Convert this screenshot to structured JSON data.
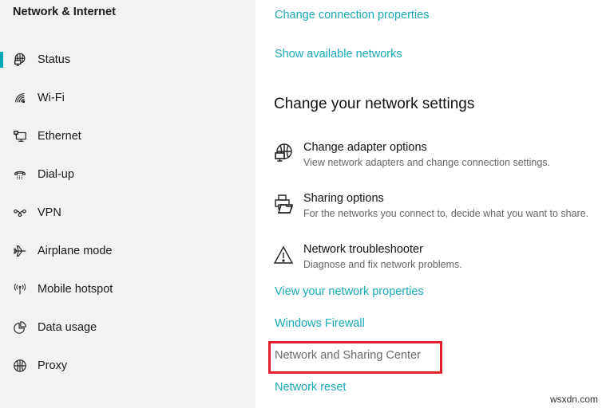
{
  "sidebar": {
    "title": "Network & Internet",
    "accent_color": "#00a8b5",
    "items": [
      {
        "label": "Status",
        "icon": "globe-monitor-icon",
        "selected": true
      },
      {
        "label": "Wi-Fi",
        "icon": "wifi-icon",
        "selected": false
      },
      {
        "label": "Ethernet",
        "icon": "ethernet-icon",
        "selected": false
      },
      {
        "label": "Dial-up",
        "icon": "phone-icon",
        "selected": false
      },
      {
        "label": "VPN",
        "icon": "vpn-icon",
        "selected": false
      },
      {
        "label": "Airplane mode",
        "icon": "airplane-icon",
        "selected": false
      },
      {
        "label": "Mobile hotspot",
        "icon": "hotspot-icon",
        "selected": false
      },
      {
        "label": "Data usage",
        "icon": "pie-chart-icon",
        "selected": false
      },
      {
        "label": "Proxy",
        "icon": "globe-icon",
        "selected": false
      }
    ]
  },
  "main": {
    "top_links": [
      "Change connection properties",
      "Show available networks"
    ],
    "section_title": "Change your network settings",
    "options": [
      {
        "title": "Change adapter options",
        "description": "View network adapters and change connection settings.",
        "icon": "adapter-globe-icon"
      },
      {
        "title": "Sharing options",
        "description": "For the networks you connect to, decide what you want to share.",
        "icon": "sharing-printer-icon"
      },
      {
        "title": "Network troubleshooter",
        "description": "Diagnose and fix network problems.",
        "icon": "warning-icon"
      }
    ],
    "bottom_links": [
      {
        "label": "View your network properties",
        "highlighted": false
      },
      {
        "label": "Windows Firewall",
        "highlighted": false
      },
      {
        "label": "Network and Sharing Center",
        "highlighted": true
      },
      {
        "label": "Network reset",
        "highlighted": false
      }
    ],
    "link_color": "#1aa9b8",
    "highlight_color": "#e0202c"
  },
  "watermark": "wsxdn.com"
}
